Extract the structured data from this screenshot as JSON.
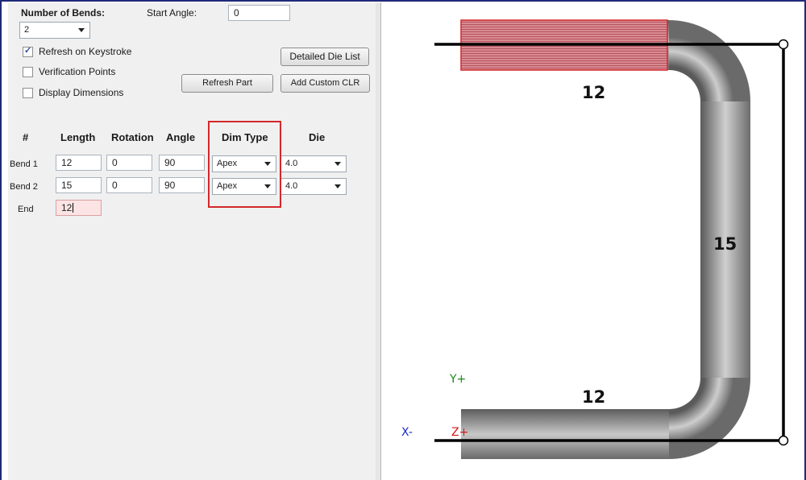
{
  "top_controls": {
    "number_of_bends_label": "Number of Bends:",
    "number_of_bends_value": "2",
    "start_angle_label": "Start Angle:",
    "start_angle_value": "0"
  },
  "options": [
    {
      "label": "Refresh on Keystroke",
      "checked": true
    },
    {
      "label": "Verification Points",
      "checked": false
    },
    {
      "label": "Display Dimensions",
      "checked": false
    }
  ],
  "buttons": {
    "detailed_die_list": "Detailed Die List",
    "refresh_part": "Refresh Part",
    "add_custom_clr": "Add Custom CLR"
  },
  "table": {
    "headers": [
      "#",
      "Length",
      "Rotation",
      "Angle",
      "Dim Type",
      "Die"
    ],
    "rows": [
      {
        "name": "Bend 1",
        "length": "12",
        "rotation": "0",
        "angle": "90",
        "dim_type": "Apex",
        "die": "4.0"
      },
      {
        "name": "Bend 2",
        "length": "15",
        "rotation": "0",
        "angle": "90",
        "dim_type": "Apex",
        "die": "4.0"
      }
    ],
    "end": {
      "name": "End",
      "length": "12"
    }
  },
  "viewport": {
    "dimensions": [
      "12",
      "15",
      "12"
    ],
    "axis_labels": {
      "y": "Y+",
      "x": "X-",
      "z": "Z+"
    },
    "colors": {
      "tube": "#8a8a8a",
      "highlight": "#d94a55",
      "axis_y": "#1a8a1a",
      "axis_x": "#1a2ad0",
      "axis_z": "#d01a1a",
      "highlight_box": "#d3282b"
    }
  }
}
